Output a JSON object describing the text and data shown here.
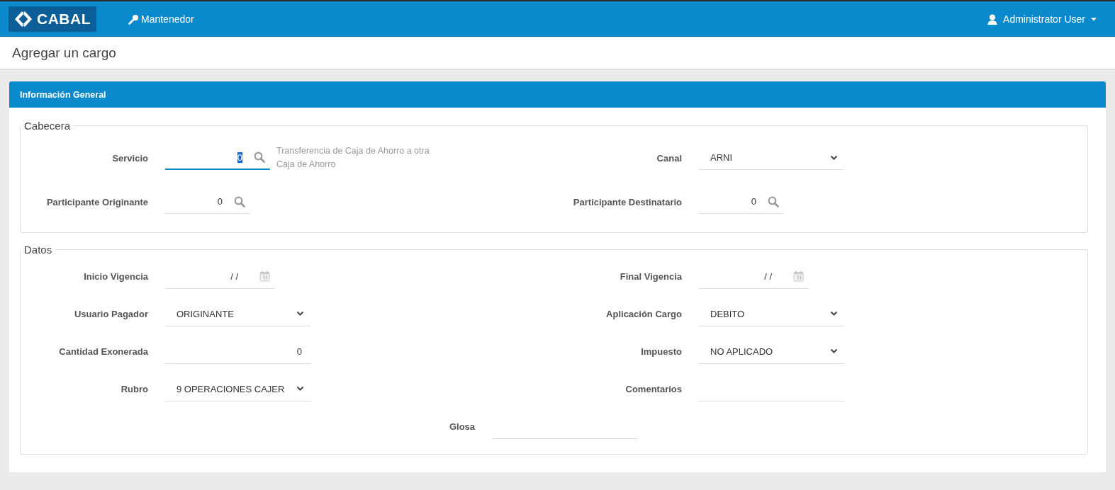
{
  "navbar": {
    "brand": "CABAL",
    "menu": [
      {
        "label": "Mantenedor"
      }
    ],
    "user": "Administrator User"
  },
  "page_title": "Agregar un cargo",
  "panel": {
    "title": "Información General",
    "sections": [
      {
        "legend": "Cabecera",
        "rows": [
          {
            "fields": [
              {
                "kind": "lookup",
                "label": "Servicio",
                "value": "0",
                "focused": true,
                "description": "Transferencia de Caja de Ahorro a otra Caja de Ahorro"
              },
              {
                "kind": "select",
                "label": "Canal",
                "value": "ARNI",
                "focused": false
              }
            ]
          },
          {
            "fields": [
              {
                "kind": "lookup",
                "label": "Participante Originante",
                "value": "0",
                "focused": false
              },
              {
                "kind": "lookup",
                "label": "Participante Destinatario",
                "value": "0",
                "focused": false
              }
            ]
          }
        ]
      },
      {
        "legend": "Datos",
        "rows": [
          {
            "fields": [
              {
                "kind": "date",
                "label": "Inicio Vigencia",
                "value": "/ /",
                "focused": false
              },
              {
                "kind": "date",
                "label": "Final Vigencia",
                "value": "/ /",
                "focused": false
              }
            ]
          },
          {
            "fields": [
              {
                "kind": "select",
                "label": "Usuario Pagador",
                "value": "ORIGINANTE",
                "focused": false
              },
              {
                "kind": "select",
                "label": "Aplicación Cargo",
                "value": "DEBITO",
                "focused": false
              }
            ]
          },
          {
            "fields": [
              {
                "kind": "number",
                "label": "Cantidad Exonerada",
                "value": "0",
                "focused": false
              },
              {
                "kind": "select",
                "label": "Impuesto",
                "value": "NO APLICADO",
                "focused": false
              }
            ]
          },
          {
            "fields": [
              {
                "kind": "select",
                "label": "Rubro",
                "value": "9 OPERACIONES CAJER",
                "focused": false
              },
              {
                "kind": "text",
                "label": "Comentarios",
                "focused": false
              }
            ]
          },
          {
            "fields": [
              {
                "kind": "text",
                "label": "Glosa",
                "focused": false
              }
            ]
          }
        ]
      }
    ]
  }
}
